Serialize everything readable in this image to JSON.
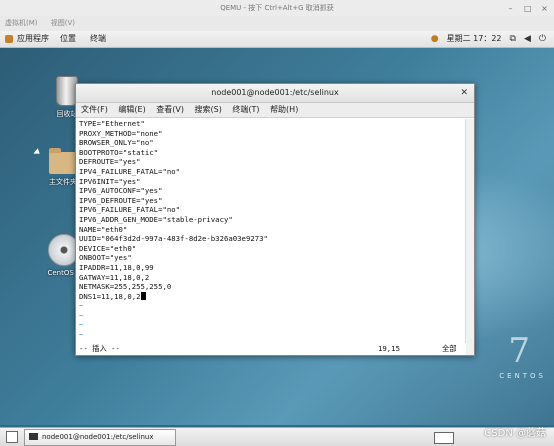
{
  "qemu": {
    "title": "QEMU - 按下 Ctrl+Alt+G 取消抓获",
    "menu": [
      "虚拟机(M)",
      "视图(V)"
    ]
  },
  "panel": {
    "apps": "应用程序",
    "places": "位置",
    "terminal": "终端",
    "datetime": "星期二 17：22"
  },
  "desktop": {
    "icons": [
      {
        "label": "回收站"
      },
      {
        "label": "主文件夹"
      },
      {
        "label": "CentOS 7"
      }
    ],
    "brand_number": "7",
    "brand_word": "CENTOS"
  },
  "terminal": {
    "title": "node001@node001:/etc/selinux",
    "menu": [
      "文件(F)",
      "编辑(E)",
      "查看(V)",
      "搜索(S)",
      "终端(T)",
      "帮助(H)"
    ],
    "lines": [
      "TYPE=\"Ethernet\"",
      "PROXY_METHOD=\"none\"",
      "BROWSER_ONLY=\"no\"",
      "BOOTPROTO=\"static\"",
      "DEFROUTE=\"yes\"",
      "IPV4_FAILURE_FATAL=\"no\"",
      "IPV6INIT=\"yes\"",
      "IPV6_AUTOCONF=\"yes\"",
      "IPV6_DEFROUTE=\"yes\"",
      "IPV6_FAILURE_FATAL=\"no\"",
      "IPV6_ADDR_GEN_MODE=\"stable-privacy\"",
      "NAME=\"eth0\"",
      "UUID=\"064f3d2d-997a-483f-8d2e-b326a03e9273\"",
      "DEVICE=\"eth0\"",
      "ONBOOT=\"yes\"",
      "IPADDR=11,18,0,99",
      "GATWAY=11,18,0,2",
      "NETMASK=255,255,255,0"
    ],
    "last_line": "DNS1=11,18,0,2",
    "tilde_count": 5,
    "status_mode": "-- 插入 --",
    "status_pos": "19,15",
    "status_view": "全部"
  },
  "taskbar": {
    "item": "node001@node001:/etc/selinux",
    "watermark": "CSDN @蘑菇"
  }
}
